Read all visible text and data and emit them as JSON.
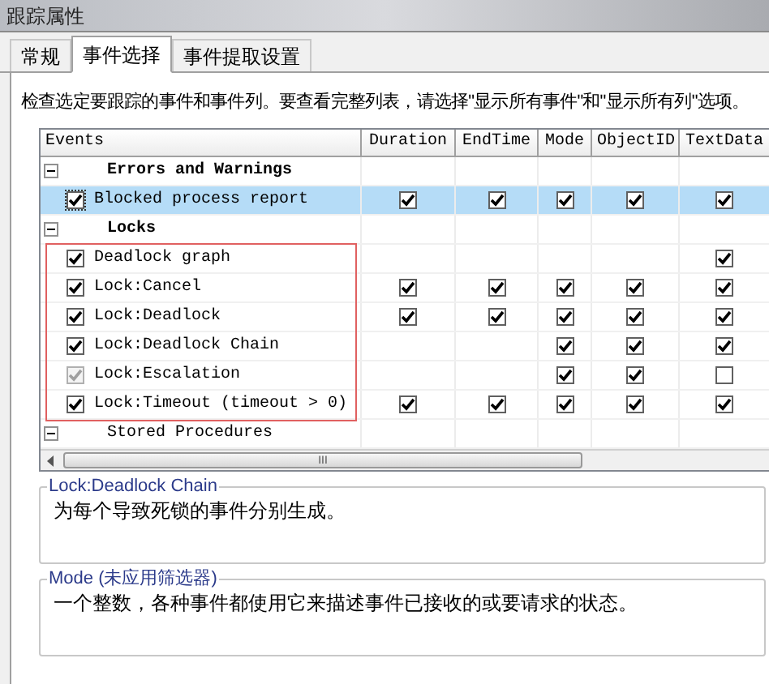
{
  "window": {
    "title": "跟踪属性"
  },
  "tabs": [
    {
      "label": "常规",
      "selected": false
    },
    {
      "label": "事件选择",
      "selected": true
    },
    {
      "label": "事件提取设置",
      "selected": false
    }
  ],
  "instruction": "检查选定要跟踪的事件和事件列。要查看完整列表，请选择\"显示所有事件\"和\"显示所有列\"选项。",
  "grid": {
    "columns": [
      "Events",
      "Duration",
      "EndTime",
      "Mode",
      "ObjectID",
      "TextData"
    ],
    "rows": [
      {
        "kind": "group",
        "label": "Errors and Warnings",
        "expanded": true,
        "bold": true
      },
      {
        "kind": "event",
        "label": "Blocked process report",
        "checked": true,
        "disabled": false,
        "selected": true,
        "cells": [
          true,
          true,
          true,
          true,
          true
        ]
      },
      {
        "kind": "group",
        "label": "Locks",
        "expanded": true,
        "bold": true
      },
      {
        "kind": "event",
        "label": "Deadlock graph",
        "checked": true,
        "disabled": false,
        "selected": false,
        "cells": [
          null,
          null,
          null,
          null,
          true
        ]
      },
      {
        "kind": "event",
        "label": "Lock:Cancel",
        "checked": true,
        "disabled": false,
        "selected": false,
        "cells": [
          true,
          true,
          true,
          true,
          true
        ]
      },
      {
        "kind": "event",
        "label": "Lock:Deadlock",
        "checked": true,
        "disabled": false,
        "selected": false,
        "cells": [
          true,
          true,
          true,
          true,
          true
        ]
      },
      {
        "kind": "event",
        "label": "Lock:Deadlock Chain",
        "checked": true,
        "disabled": false,
        "selected": false,
        "cells": [
          null,
          null,
          true,
          true,
          true
        ]
      },
      {
        "kind": "event",
        "label": "Lock:Escalation",
        "checked": true,
        "disabled": true,
        "selected": false,
        "cells": [
          null,
          null,
          true,
          true,
          false
        ]
      },
      {
        "kind": "event",
        "label": "Lock:Timeout (timeout > 0)",
        "checked": true,
        "disabled": false,
        "selected": false,
        "cells": [
          true,
          true,
          true,
          true,
          true
        ]
      },
      {
        "kind": "group",
        "label": "Stored Procedures",
        "expanded": true,
        "bold": false
      }
    ]
  },
  "scrollbar": {
    "grip": "III"
  },
  "descriptions": [
    {
      "title": "Lock:Deadlock Chain",
      "text": "为每个导致死锁的事件分别生成。"
    },
    {
      "title": "Mode (未应用筛选器)",
      "text": "一个整数，各种事件都使用它来描述事件已接收的或要请求的状态。"
    }
  ]
}
